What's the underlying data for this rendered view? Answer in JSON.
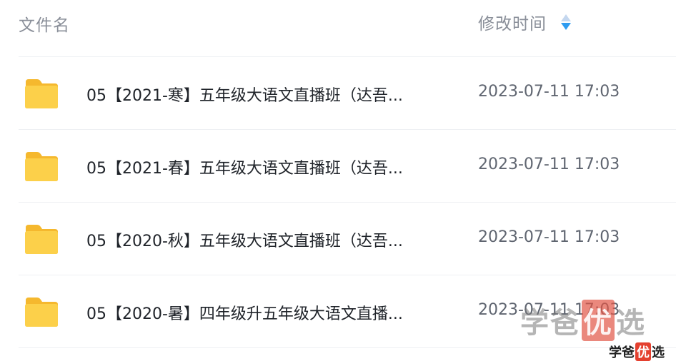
{
  "header": {
    "name_label": "文件名",
    "time_label": "修改时间",
    "sort_icon": "sort-icon"
  },
  "files": [
    {
      "icon": "folder-icon",
      "name": "05【2021-寒】五年级大语文直播班（达吾...",
      "time": "2023-07-11 17:03"
    },
    {
      "icon": "folder-icon",
      "name": "05【2021-春】五年级大语文直播班（达吾...",
      "time": "2023-07-11 17:03"
    },
    {
      "icon": "folder-icon",
      "name": "05【2020-秋】五年级大语文直播班（达吾...",
      "time": "2023-07-11 17:03"
    },
    {
      "icon": "folder-icon",
      "name": "05【2020-暑】四年级升五年级大语文直播...",
      "time": "2023-07-11 17:03"
    }
  ],
  "watermark": {
    "part1": "学爸",
    "highlight": "优",
    "part2": "选"
  },
  "colors": {
    "folder": "#fcc93f",
    "sort_active": "#2d9bf0",
    "watermark_red": "#e4402f"
  }
}
